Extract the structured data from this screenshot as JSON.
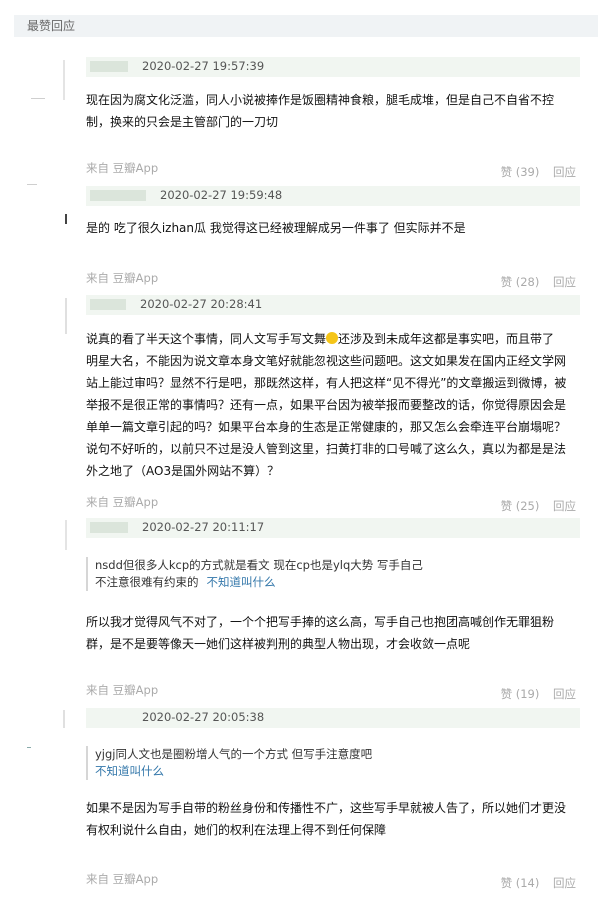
{
  "section_title": "最赞回应",
  "source_prefix": "来自",
  "source_app": "豆瓣App",
  "vote_label": "赞",
  "reply_label": "回应",
  "comments": [
    {
      "time": "2020-02-27 19:57:39",
      "lines": [
        "现在因为腐文化泛滥，同人小说被捧作是饭圈精神食粮，腿毛成堆，但是自己不自省不控",
        "制，换来的只会是主管部门的一刀切"
      ],
      "votes": "(39)"
    },
    {
      "time": "2020-02-27 19:59:48",
      "lines": [
        "是的 吃了很久izhan瓜 我觉得这已经被理解成另一件事了 但实际并不是"
      ],
      "votes": "(28)"
    },
    {
      "time": "2020-02-27 20:28:41",
      "line1_before": "说真的看了半天这个事情，同人文写手写文舞",
      "line1_after": "还涉及到未成年这都是事实吧，而且带了",
      "lines": [
        "明星大名，不能因为说文章本身文笔好就能忽视这些问题吧。这文如果发在国内正经文学网",
        "站上能过审吗？显然不行是吧，那既然这样，有人把这样“见不得光”的文章搬运到微博，被",
        "举报不是很正常的事情吗？还有一点，如果平台因为被举报而要整改的话，你觉得原因会是",
        "单单一篇文章引起的吗？如果平台本身的生态是正常健康的，那又怎么会牵连平台崩塌呢？",
        "说句不好听的，以前只不过是没人管到这里，扫黄打非的口号喊了这么久，真以为都是是法",
        "外之地了（AO3是国外网站不算）？"
      ],
      "votes": "(25)"
    },
    {
      "time": "2020-02-27 20:11:17",
      "quote_lines": [
        "nsdd但很多人kcp的方式就是看文 现在cp也是ylq大势 写手自己",
        "不注意很难有约束的"
      ],
      "quote_author": "不知道叫什么",
      "lines": [
        "所以我才觉得风气不对了，一个个把写手捧的这么高，写手自己也抱团高喊创作无罪狙粉",
        "群，是不是要等像天一她们这样被判刑的典型人物出现，才会收敛一点呢"
      ],
      "votes": "(19)"
    },
    {
      "time": "2020-02-27 20:05:38",
      "quote_lines": [
        "yjgj同人文也是圈粉增人气的一个方式 但写手注意度吧"
      ],
      "quote_author": "不知道叫什么",
      "lines": [
        "如果不是因为写手自带的粉丝身份和传播性不广，这些写手早就被人告了，所以她们才更没",
        "有权利说什么自由，她们的权利在法理上得不到任何保障"
      ],
      "votes": "(14)"
    }
  ]
}
